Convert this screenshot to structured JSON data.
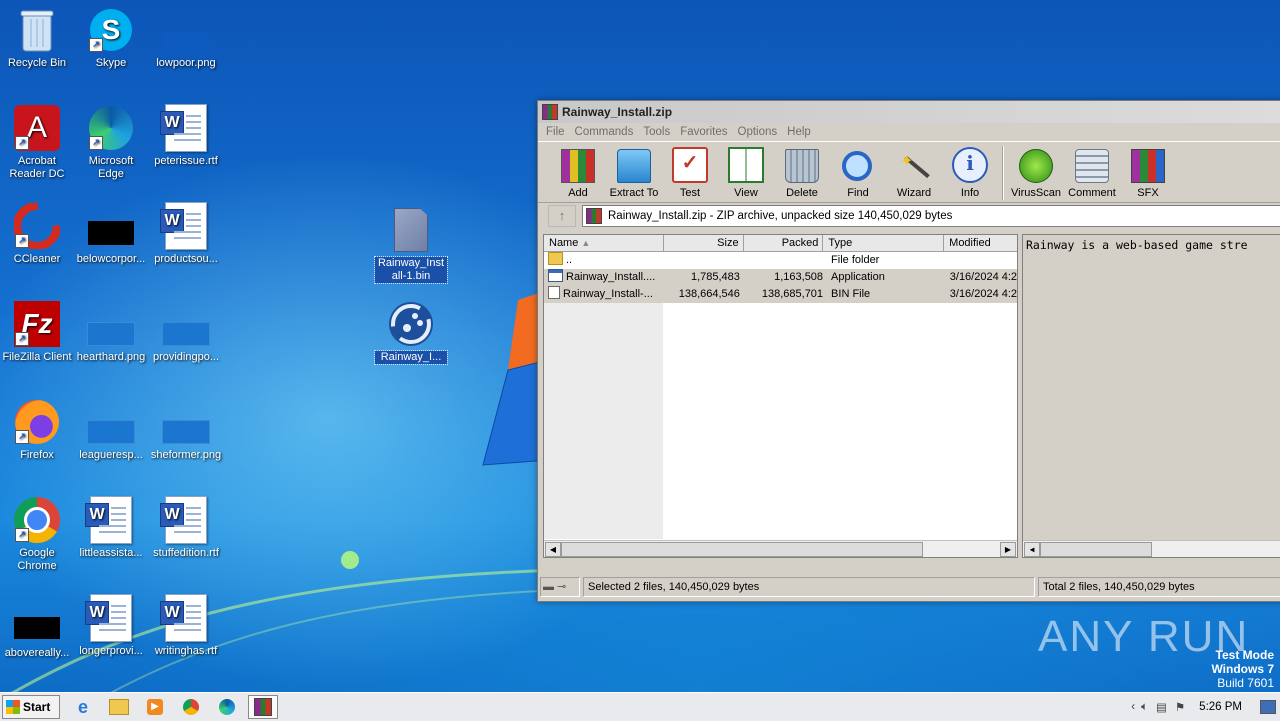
{
  "desktop": {
    "icons": [
      {
        "label": "Recycle Bin"
      },
      {
        "label": "Skype"
      },
      {
        "label": "lowpoor.png"
      },
      {
        "label": "Acrobat Reader DC"
      },
      {
        "label": "Microsoft Edge"
      },
      {
        "label": "peterissue.rtf"
      },
      {
        "label": "CCleaner"
      },
      {
        "label": "belowcorpor..."
      },
      {
        "label": "productsou..."
      },
      {
        "label": "Rainway_Install-1.bin"
      },
      {
        "label": "FileZilla Client"
      },
      {
        "label": "hearthard.png"
      },
      {
        "label": "providingpo..."
      },
      {
        "label": "Rainway_I..."
      },
      {
        "label": "Firefox"
      },
      {
        "label": "leagueresp..."
      },
      {
        "label": "sheformer.png"
      },
      {
        "label": "Google Chrome"
      },
      {
        "label": "littleassista..."
      },
      {
        "label": "stuffedition.rtf"
      },
      {
        "label": "abovereally..."
      },
      {
        "label": "longerprovi..."
      },
      {
        "label": "writinghas.rtf"
      }
    ]
  },
  "window": {
    "title": "Rainway_Install.zip",
    "menu": [
      "File",
      "Commands",
      "Tools",
      "Favorites",
      "Options",
      "Help"
    ],
    "toolbar": [
      "Add",
      "Extract To",
      "Test",
      "View",
      "Delete",
      "Find",
      "Wizard",
      "Info",
      "VirusScan",
      "Comment",
      "SFX"
    ],
    "address": "Rainway_Install.zip - ZIP archive, unpacked size 140,450,029 bytes",
    "columns": [
      "Name",
      "Size",
      "Packed",
      "Type",
      "Modified"
    ],
    "rows": [
      {
        "name": "..",
        "size": "",
        "packed": "",
        "type": "File folder",
        "modified": ""
      },
      {
        "name": "Rainway_Install....",
        "size": "1,785,483",
        "packed": "1,163,508",
        "type": "Application",
        "modified": "3/16/2024 4:2"
      },
      {
        "name": "Rainway_Install-...",
        "size": "138,664,546",
        "packed": "138,685,701",
        "type": "BIN File",
        "modified": "3/16/2024 4:2"
      }
    ],
    "preview_text": "Rainway is a web-based game stre",
    "status_left": "Selected 2 files, 140,450,029 bytes",
    "status_right": "Total 2 files, 140,450,029 bytes"
  },
  "taskbar": {
    "start_label": "Start",
    "clock": "5:26 PM"
  },
  "watermark": {
    "text": "ANY RUN",
    "test_mode": "Test Mode",
    "os": "Windows 7",
    "build": "Build 7601"
  }
}
